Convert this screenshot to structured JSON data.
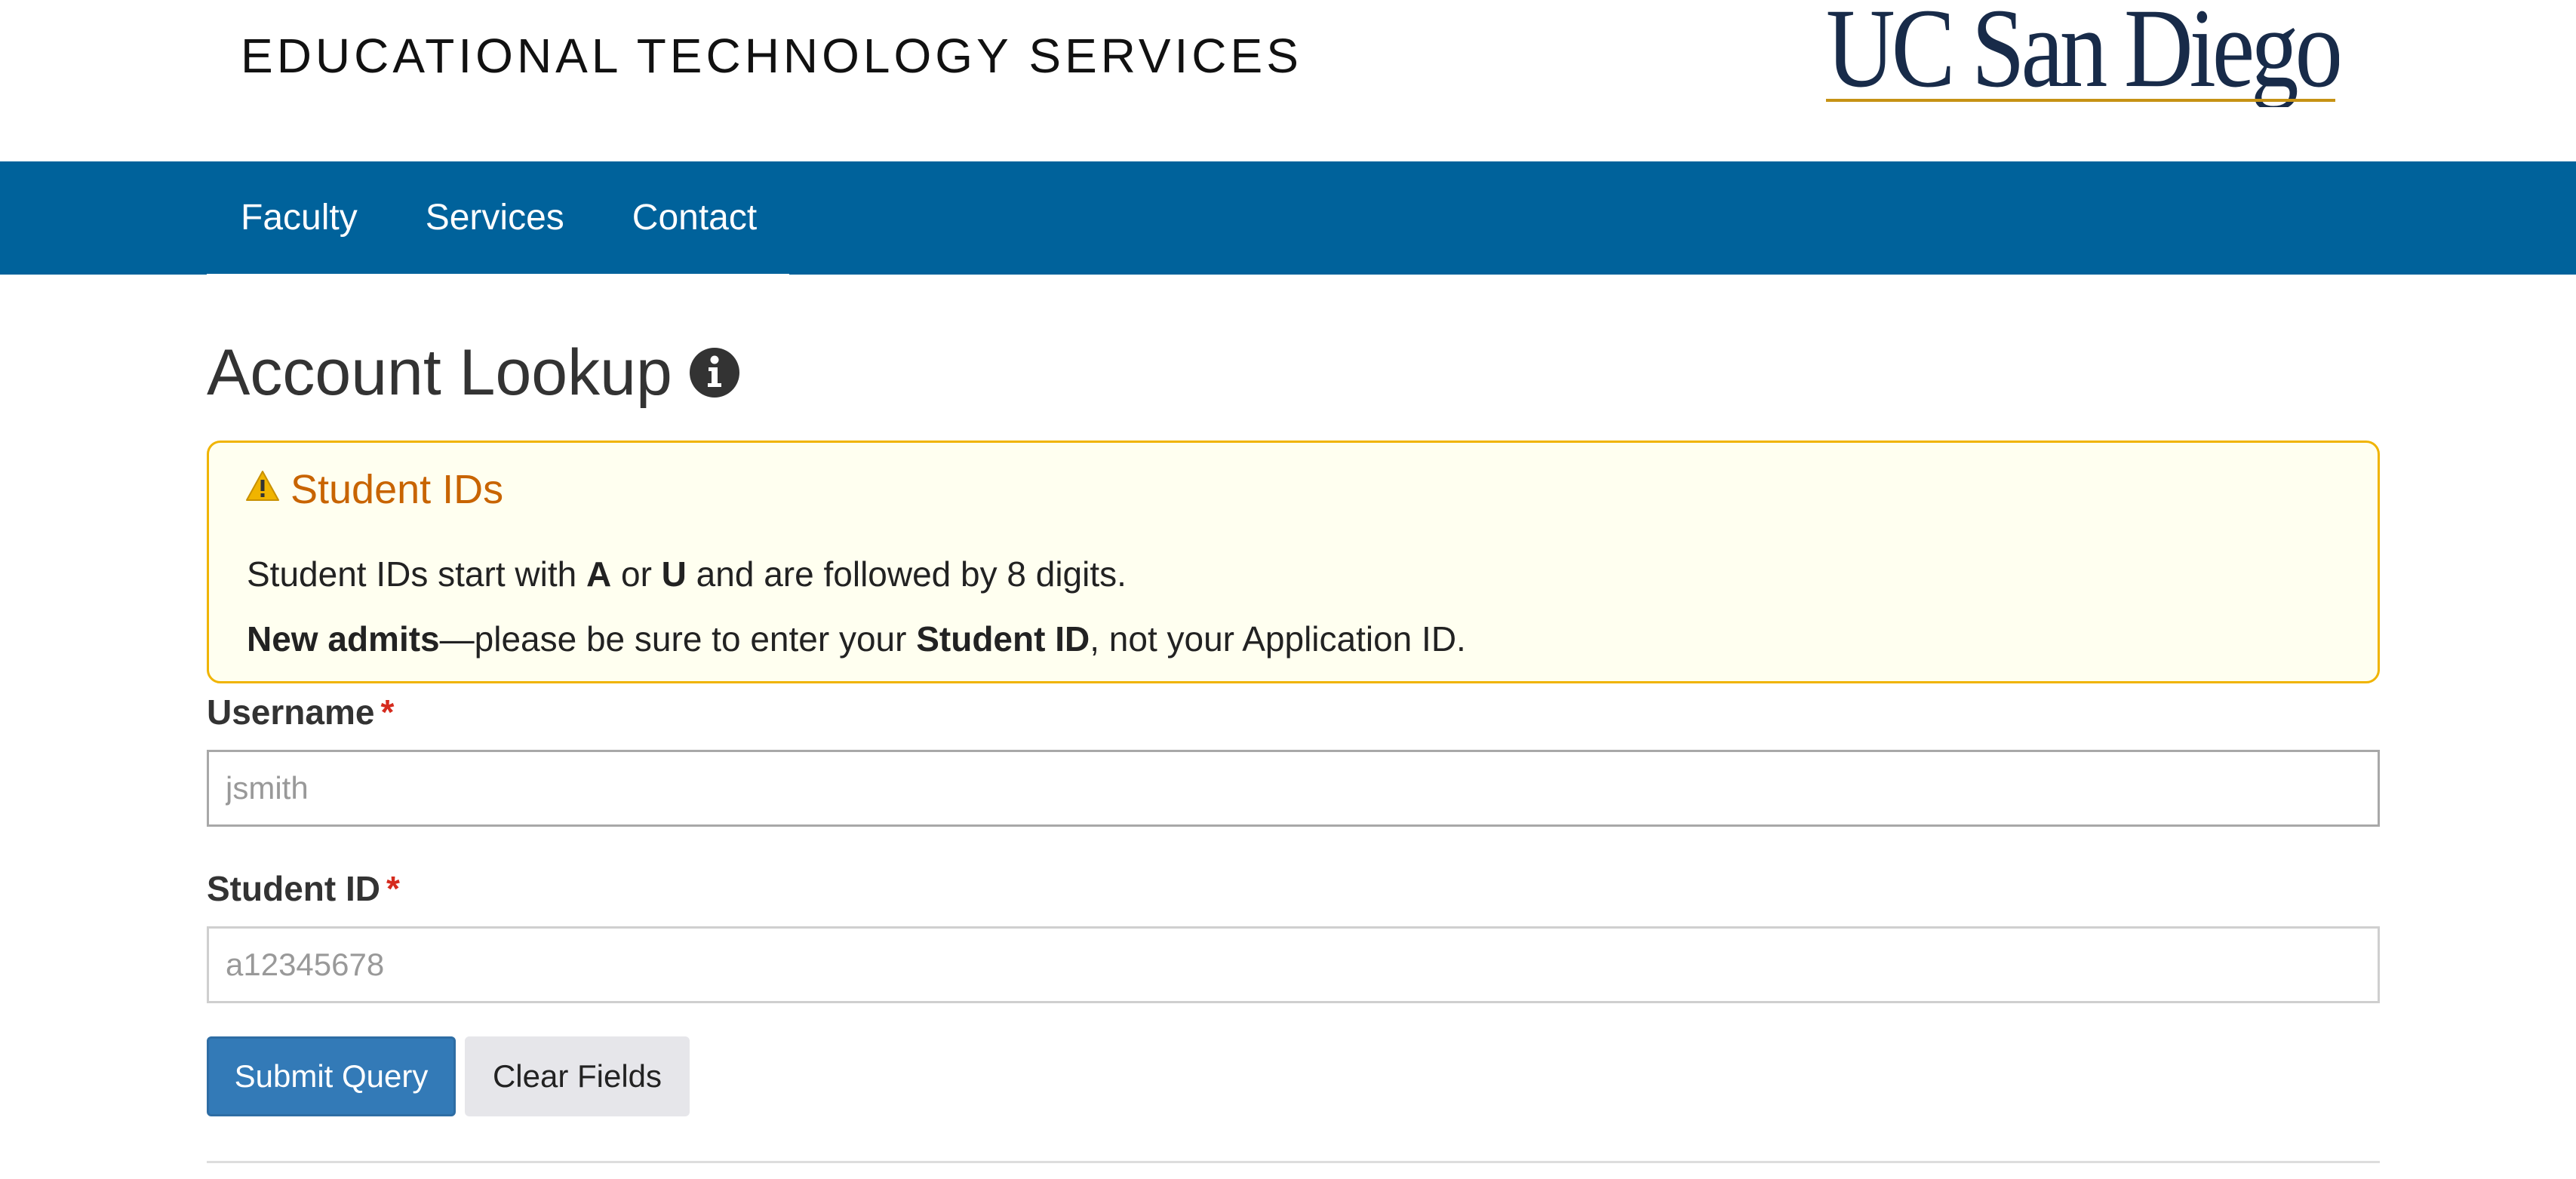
{
  "header": {
    "site_title": "EDUCATIONAL TECHNOLOGY SERVICES",
    "logo_text": "UC San Diego"
  },
  "nav": {
    "items": [
      {
        "label": "Faculty"
      },
      {
        "label": "Services"
      },
      {
        "label": "Contact"
      }
    ]
  },
  "page": {
    "title": "Account Lookup"
  },
  "alert": {
    "title": "Student IDs",
    "line1": {
      "prefix": "Student IDs start with ",
      "bold1": "A",
      "mid": " or ",
      "bold2": "U",
      "suffix": " and are followed by 8 digits."
    },
    "line2": {
      "bold1": "New admits",
      "mid": "—please be sure to enter your ",
      "bold2": "Student ID",
      "suffix": ", not your Application ID."
    }
  },
  "form": {
    "username": {
      "label": "Username",
      "required_marker": "*",
      "placeholder": "jsmith",
      "value": ""
    },
    "student_id": {
      "label": "Student ID",
      "required_marker": "*",
      "placeholder": "a12345678",
      "value": ""
    },
    "submit_label": "Submit Query",
    "clear_label": "Clear Fields"
  },
  "colors": {
    "nav_background": "#00629b",
    "alert_background": "#fffff0",
    "alert_border": "#f0b400",
    "alert_title": "#c86400",
    "primary_button": "#337ab7",
    "required_marker": "#d52b1e",
    "logo_navy": "#182b49",
    "logo_gold": "#c69214"
  },
  "icons": {
    "info": "info-circle-icon",
    "warning": "warning-triangle-icon"
  }
}
